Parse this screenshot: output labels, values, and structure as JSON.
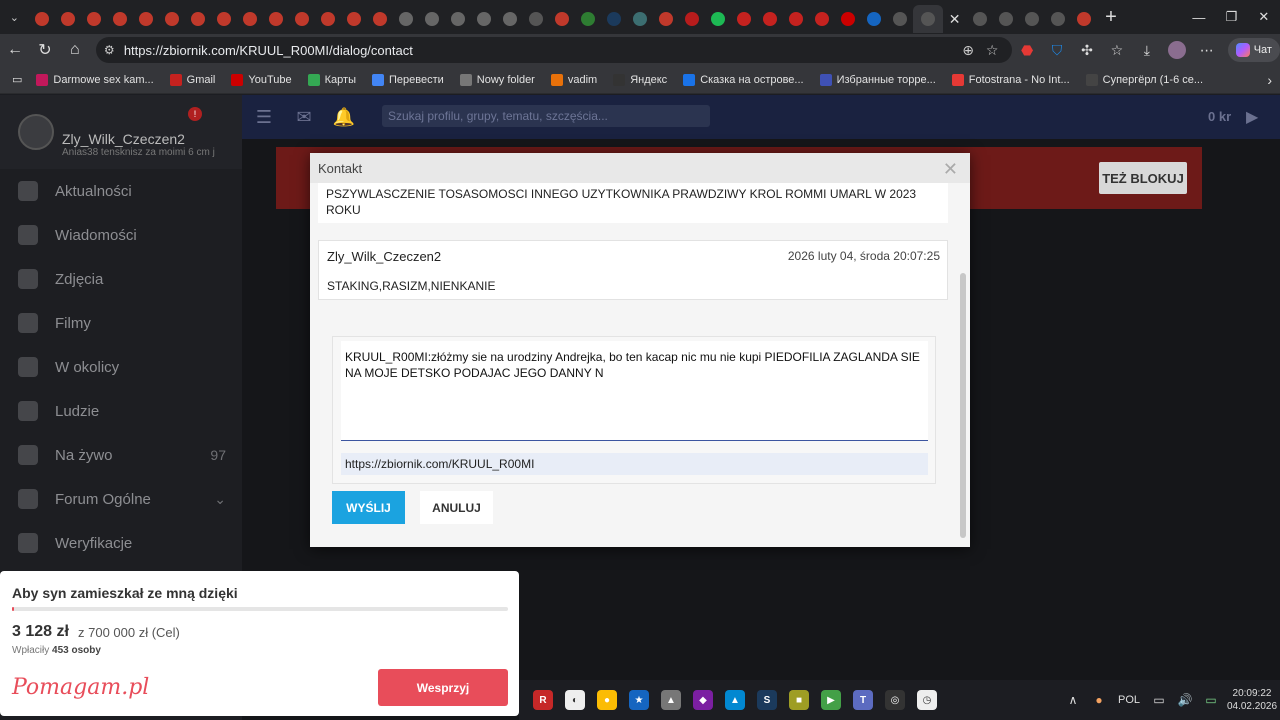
{
  "browser": {
    "tabs": [
      {
        "icon": "target-icon",
        "color": "#c0392b"
      },
      {
        "icon": "target-icon",
        "color": "#c0392b"
      },
      {
        "icon": "target-icon",
        "color": "#c0392b"
      },
      {
        "icon": "target-icon",
        "color": "#c0392b"
      },
      {
        "icon": "target-icon",
        "color": "#c0392b"
      },
      {
        "icon": "target-icon",
        "color": "#c0392b"
      },
      {
        "icon": "target-icon",
        "color": "#c0392b"
      },
      {
        "icon": "target-icon",
        "color": "#c0392b"
      },
      {
        "icon": "target-icon",
        "color": "#c0392b"
      },
      {
        "icon": "target-icon",
        "color": "#c0392b"
      },
      {
        "icon": "target-icon",
        "color": "#c0392b"
      },
      {
        "icon": "target-icon",
        "color": "#c0392b"
      },
      {
        "icon": "target-icon",
        "color": "#c0392b"
      },
      {
        "icon": "target-icon",
        "color": "#c0392b"
      },
      {
        "icon": "film-icon",
        "color": "#666666"
      },
      {
        "icon": "film-icon",
        "color": "#666666"
      },
      {
        "icon": "film-icon",
        "color": "#666666"
      },
      {
        "icon": "film-icon",
        "color": "#666666"
      },
      {
        "icon": "film-icon",
        "color": "#666666"
      },
      {
        "icon": "clapper-icon",
        "color": "#555555"
      },
      {
        "icon": "cdn-icon",
        "color": "#c0392b"
      },
      {
        "icon": "leaf-icon",
        "color": "#2e7d32"
      },
      {
        "icon": "steam-icon",
        "color": "#1b3a5c"
      },
      {
        "icon": "image-icon",
        "color": "#3c6e71"
      },
      {
        "icon": "pinterest-icon",
        "color": "#c0392b"
      },
      {
        "icon": "media-icon",
        "color": "#b71c1c"
      },
      {
        "icon": "spotify-icon",
        "color": "#1db954"
      },
      {
        "icon": "gmail-icon",
        "color": "#c5221f"
      },
      {
        "icon": "gmail-icon",
        "color": "#c5221f"
      },
      {
        "icon": "gmail-icon",
        "color": "#c5221f"
      },
      {
        "icon": "gmail-icon",
        "color": "#c5221f"
      },
      {
        "icon": "youtube-icon",
        "color": "#cc0000"
      },
      {
        "icon": "arrow-icon",
        "color": "#1565c0"
      },
      {
        "icon": "globe-icon",
        "color": "#555555"
      },
      {
        "icon": "globe-icon",
        "color": "#555555",
        "active": true
      },
      {
        "icon": "globe-icon",
        "color": "#555555"
      },
      {
        "icon": "globe-icon",
        "color": "#555555"
      },
      {
        "icon": "globe-icon",
        "color": "#555555"
      },
      {
        "icon": "zeta-icon",
        "color": "#555555"
      },
      {
        "icon": "cda-icon",
        "color": "#c0392b"
      }
    ],
    "tab_close_glyph": "✕",
    "new_tab_glyph": "+",
    "chat_label": "Чат",
    "url": "https://zbiornik.com/KRUUL_R00MI/dialog/contact",
    "bookmarks": [
      {
        "label": "Darmowe sex kam...",
        "color": "#c2185b"
      },
      {
        "label": "Gmail",
        "color": "#c5221f"
      },
      {
        "label": "YouTube",
        "color": "#cc0000"
      },
      {
        "label": "Карты",
        "color": "#34a853"
      },
      {
        "label": "Перевести",
        "color": "#4285f4"
      },
      {
        "label": "Nowy folder",
        "color": "#777777"
      },
      {
        "label": "vadim",
        "color": "#e8710a"
      },
      {
        "label": "Яндекс",
        "color": "#333333"
      },
      {
        "label": "Сказка на острове...",
        "color": "#1a73e8"
      },
      {
        "label": "Избранные торре...",
        "color": "#3f51b5"
      },
      {
        "label": "Fotostrana - No Int...",
        "color": "#e53935"
      },
      {
        "label": "Супергёрл (1-6 се...",
        "color": "#444444"
      }
    ]
  },
  "site": {
    "profile": {
      "name": "Zly_Wilk_Czeczen2",
      "status": "Anias38 tensknisz za moimi 6 cm j",
      "badge": "!"
    },
    "sidebar": [
      {
        "label": "Aktualności"
      },
      {
        "label": "Wiadomości"
      },
      {
        "label": "Zdjęcia"
      },
      {
        "label": "Filmy"
      },
      {
        "label": "W okolicy"
      },
      {
        "label": "Ludzie"
      },
      {
        "label": "Na żywo",
        "count": "97"
      },
      {
        "label": "Forum Ogólne",
        "chevron": "⌄"
      },
      {
        "label": "Weryfikacje"
      }
    ],
    "search_placeholder": "Szukaj profilu, grupy, tematu, szczęścia...",
    "wallet": "0 kr",
    "block_button": "TEŻ BLOKUJ"
  },
  "dialog": {
    "title": "Kontakt",
    "close_glyph": "✕",
    "messages": [
      {
        "text": "PSZYWLASCZENIE TOSASOMOSCI INNEGO UZYTKOWNIKA PRAWDZIWY KROL ROMMI UMARL W 2023 ROKU"
      },
      {
        "author": "Zly_Wilk_Czeczen2",
        "date": "2026 luty 04, środa 20:07:25",
        "text": "STAKING,RASIZM,NIENKANIE"
      }
    ],
    "compose_text": "KRUUL_R00MI:złóżmy sie na urodziny Andrejka, bo ten kacap nic mu nie kupi PIEDOFILIA ZAGLANDA SIE NA MOJE DETSKO PODAJAC JEGO DANNY N",
    "profile_url": "https://zbiornik.com/KRUUL_R00MI",
    "send": "WYŚLIJ",
    "cancel": "ANULUJ"
  },
  "pomagam": {
    "title": "Aby syn zamieszkał ze mną dzięki",
    "amount": "3 128 zł",
    "goal": "z 700 000 zł (Cel)",
    "donors_label": "Wpłaciły",
    "donors_value": "453 osoby",
    "logo": "Pomagam.pl",
    "button": "Wesprzyj",
    "progress_fraction": 0.0045
  },
  "taskbar": {
    "apps": [
      {
        "icon": "r-app-icon",
        "color": "#c62828",
        "glyph": "R"
      },
      {
        "icon": "compass-icon",
        "color": "#eeeeee",
        "glyph": "◐"
      },
      {
        "icon": "chrome-icon",
        "color": "#fbbc04",
        "glyph": "●"
      },
      {
        "icon": "star-app-icon",
        "color": "#1565c0",
        "glyph": "★"
      },
      {
        "icon": "hat-icon",
        "color": "#777777",
        "glyph": "▲"
      },
      {
        "icon": "colorful-app-icon",
        "color": "#7b1fa2",
        "glyph": "◆"
      },
      {
        "icon": "photos-icon",
        "color": "#0288d1",
        "glyph": "▲"
      },
      {
        "icon": "steam-icon",
        "color": "#1b3a5c",
        "glyph": "S"
      },
      {
        "icon": "game-icon",
        "color": "#9e9d24",
        "glyph": "■"
      },
      {
        "icon": "media-player-icon",
        "color": "#43a047",
        "glyph": "▶"
      },
      {
        "icon": "teams-icon",
        "color": "#5c6bc0",
        "glyph": "T"
      },
      {
        "icon": "chat-app-icon",
        "color": "#333333",
        "glyph": "◎"
      },
      {
        "icon": "clock-app-icon",
        "color": "#eeeeee",
        "glyph": "◷"
      }
    ],
    "tray": {
      "chevron": "∧",
      "mic": "🎤",
      "lang": "POL",
      "time": "20:09:22",
      "date": "04.02.2026"
    }
  }
}
